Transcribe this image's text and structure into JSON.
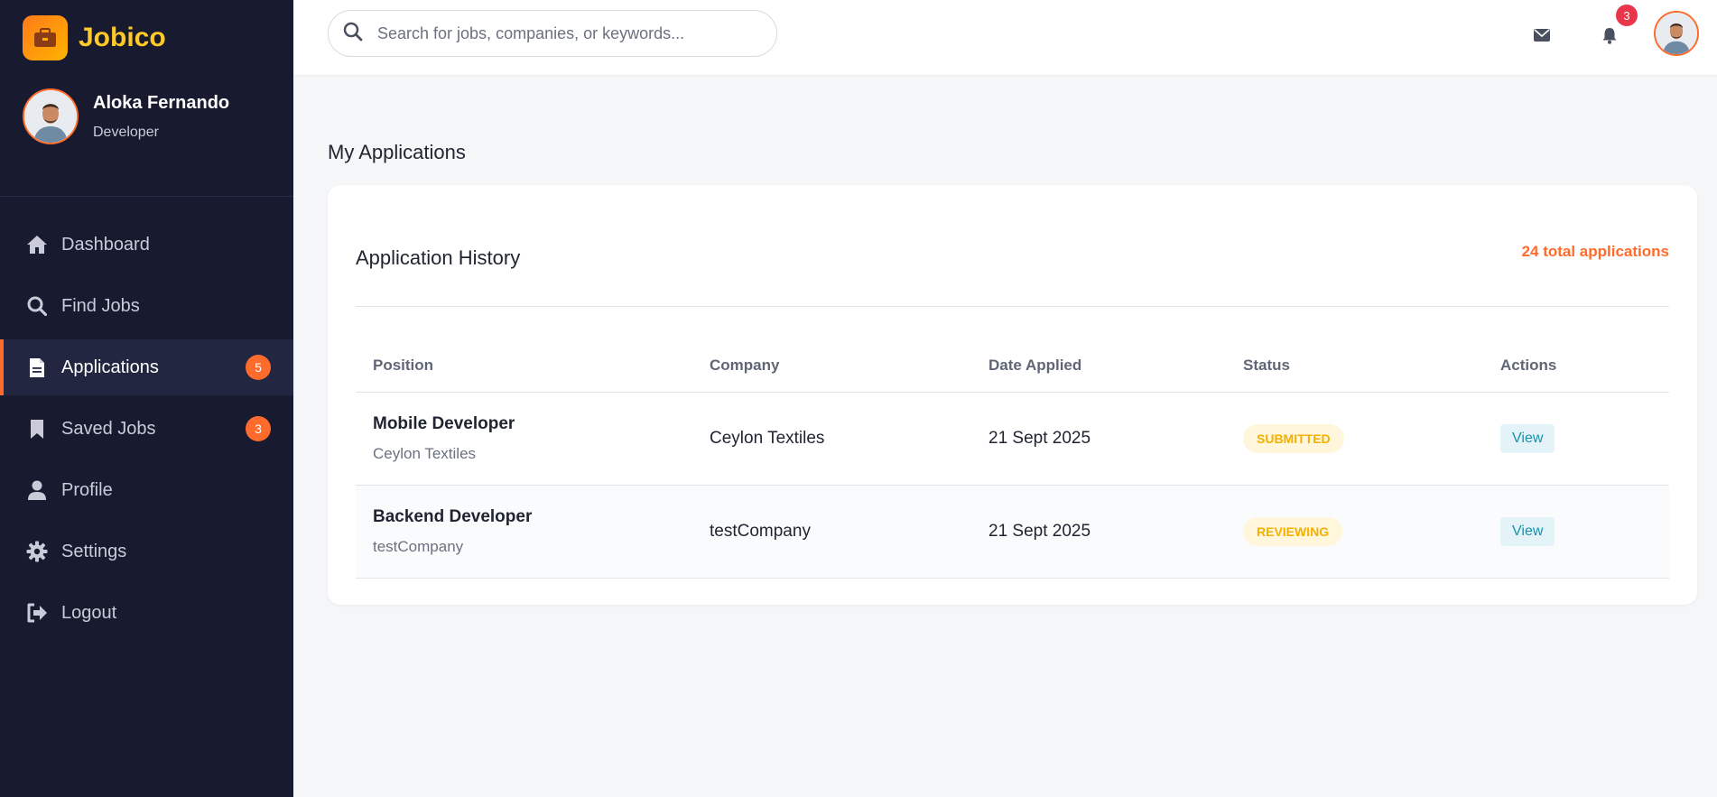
{
  "brand": {
    "name": "Jobico"
  },
  "user": {
    "name": "Aloka Fernando",
    "role": "Developer"
  },
  "sidebar": {
    "items": [
      {
        "label": "Dashboard",
        "icon": "home-icon"
      },
      {
        "label": "Find Jobs",
        "icon": "search-icon"
      },
      {
        "label": "Applications",
        "icon": "document-icon",
        "badge": "5",
        "active": true
      },
      {
        "label": "Saved Jobs",
        "icon": "bookmark-icon",
        "badge": "3"
      },
      {
        "label": "Profile",
        "icon": "user-icon"
      },
      {
        "label": "Settings",
        "icon": "gear-icon"
      },
      {
        "label": "Logout",
        "icon": "logout-icon"
      }
    ]
  },
  "header": {
    "search_placeholder": "Search for jobs, companies, or keywords...",
    "notification_count": "3"
  },
  "page": {
    "title": "My Applications"
  },
  "card": {
    "title": "Application History",
    "count_label": "24 total applications"
  },
  "table": {
    "columns": [
      "Position",
      "Company",
      "Date Applied",
      "Status",
      "Actions"
    ],
    "rows": [
      {
        "position": "Mobile Developer",
        "position_company": "Ceylon Textiles",
        "company": "Ceylon Textiles",
        "date": "21 Sept 2025",
        "status": "SUBMITTED",
        "action": "View"
      },
      {
        "position": "Backend Developer",
        "position_company": "testCompany",
        "company": "testCompany",
        "date": "21 Sept 2025",
        "status": "REVIEWING",
        "action": "View"
      }
    ]
  },
  "colors": {
    "sidebar_bg": "#181a2f",
    "accent": "#ff6b2c",
    "brand_yellow": "#ffc928",
    "status_text": "#f3b000",
    "notification_red": "#e8364a"
  }
}
